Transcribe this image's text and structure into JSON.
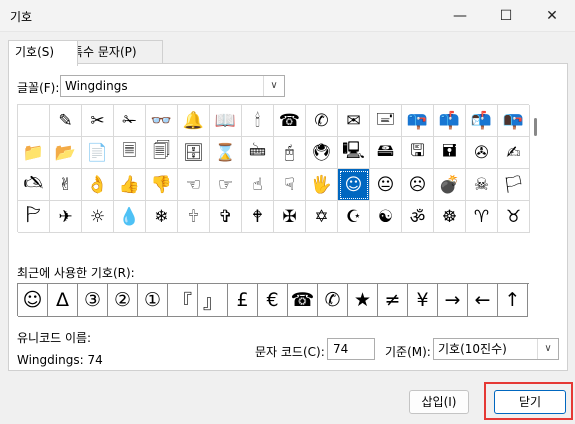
{
  "window": {
    "title": "기호",
    "minimize_glyph": "—",
    "maximize_glyph": "☐",
    "close_glyph": "✕"
  },
  "tabs": [
    {
      "label": "기호(S)",
      "active": true
    },
    {
      "label": "특수 문자(P)",
      "active": false
    }
  ],
  "font": {
    "label": "글꼴(F):",
    "value": "Wingdings"
  },
  "symbol_grid": {
    "rows": [
      [
        "",
        "✎",
        "✂",
        "✁",
        "👓",
        "🔔",
        "📖",
        "🕯",
        "☎",
        "✆",
        "✉",
        "🖃",
        "📪",
        "📫",
        "📬",
        "📭"
      ],
      [
        "📁",
        "📂",
        "📄",
        "🗏",
        "🗐",
        "🗄",
        "⌛",
        "🖮",
        "🖰",
        "🖲",
        "🖳",
        "🖴",
        "🖫",
        "🖬",
        "✇",
        "✍"
      ],
      [
        "🖎",
        "✌",
        "👌",
        "👍",
        "👎",
        "☜",
        "☞",
        "☝",
        "☟",
        "🖐",
        "☺",
        "😐",
        "☹",
        "💣",
        "☠",
        "🏳"
      ],
      [
        "🏱",
        "✈",
        "☼",
        "💧",
        "❄",
        "🕆",
        "✞",
        "🕈",
        "✠",
        "✡",
        "☪",
        "☯",
        "ॐ",
        "☸",
        "♈",
        "♉",
        "♊",
        "♋",
        "♌",
        "♍"
      ]
    ],
    "selected_symbol": "☺"
  },
  "recent": {
    "label": "최근에 사용한 기호(R):",
    "symbols": [
      "☺",
      "Δ",
      "③",
      "②",
      "①",
      "『",
      "』",
      "£",
      "€",
      "☎",
      "✆",
      "★",
      "≠",
      "¥",
      "→",
      "←",
      "↑"
    ]
  },
  "unicode_name": {
    "label": "유니코드 이름:",
    "value": "Wingdings: 74"
  },
  "char_code": {
    "label": "문자 코드(C):",
    "value": "74"
  },
  "base": {
    "label": "기준(M):",
    "value": "기호(10진수)"
  },
  "buttons": {
    "insert": "삽입(I)",
    "close": "닫기"
  }
}
